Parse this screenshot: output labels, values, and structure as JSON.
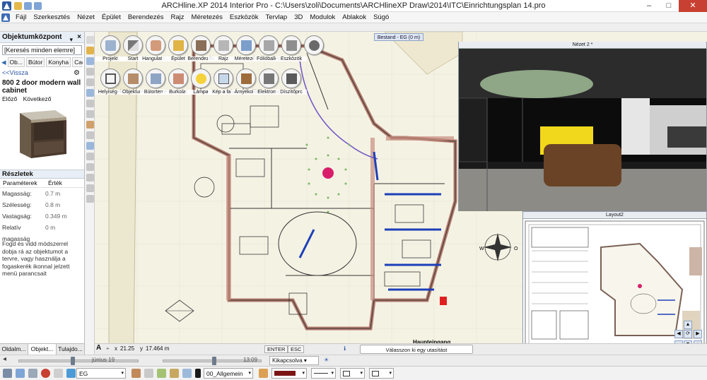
{
  "window": {
    "title": "ARCHline.XP 2014 Interior Pro - C:\\Users\\zoli\\Documents\\ARCHlineXP Draw\\2014\\ITC\\Einrichtungsplan 14.pro",
    "minimize": "–",
    "maximize": "□",
    "close": "✕"
  },
  "menu": [
    "Fájl",
    "Szerkesztés",
    "Nézet",
    "Épület",
    "Berendezés",
    "Rajz",
    "Méretezés",
    "Eszközök",
    "Tervlap",
    "3D",
    "Modulok",
    "Ablakok",
    "Súgó"
  ],
  "left_panel": {
    "title": "Objektumközpont",
    "pin": "▾ ×",
    "search_placeholder": "[Keresés minden elemre]",
    "breadcrumbs": [
      "Ob...",
      "Bútor",
      "Konyha",
      "Cad"
    ],
    "back": "<<Vissza",
    "object_name": "800 2 door modern wall cabinet",
    "prev": "Előző",
    "next": "Következő",
    "details_title": "Részletek",
    "col_param": "Paraméterek",
    "col_value": "Érték",
    "params": [
      {
        "name": "Magasság:",
        "value": "0.7 m"
      },
      {
        "name": "Szélesség:",
        "value": "0.8 m"
      },
      {
        "name": "Vastagság:",
        "value": "0.349 m"
      },
      {
        "name": "Relatív magasság",
        "value": "0 m"
      }
    ],
    "hint": "Fogd és vidd módszerrel dobja rá az objektumot a tervre, vagy használja a fogaskerék ikonnal jelzett menü parancsait",
    "tabs": [
      "Oldalm...",
      "Objekt...",
      "Tulajdo..."
    ]
  },
  "tools": [
    {
      "label": "Projekt",
      "icon": "project-icon"
    },
    {
      "label": "Start",
      "icon": "stairs-icon"
    },
    {
      "label": "Hangulat r...",
      "icon": "mood-icon"
    },
    {
      "label": "Épület",
      "icon": "building-icon"
    },
    {
      "label": "Berendezés",
      "icon": "furniture-icon"
    },
    {
      "label": "Rajz",
      "icon": "drawing-icon"
    },
    {
      "label": "Méretezés",
      "icon": "dimension-icon"
    },
    {
      "label": "Fólióballeo",
      "icon": "layers-icon"
    },
    {
      "label": "Eszközök",
      "icon": "tools-icon"
    },
    {
      "label": "Helyiségek",
      "icon": "rooms-icon"
    },
    {
      "label": "Objektum",
      "icon": "object-icon"
    },
    {
      "label": "Bútorterve",
      "icon": "furniture-plan-icon"
    },
    {
      "label": "Burkolat",
      "icon": "cladding-icon"
    },
    {
      "label": "Lámpa",
      "icon": "lamp-icon"
    },
    {
      "label": "Kép a falo",
      "icon": "wall-picture-icon"
    },
    {
      "label": "Árnyékolót",
      "icon": "shading-icon"
    },
    {
      "label": "Elektromo",
      "icon": "electric-icon"
    },
    {
      "label": "Díszítőprc",
      "icon": "decoration-icon"
    }
  ],
  "level_badge": "Bestand - EG (0 m)",
  "view3d_title": "Nézet 2 *",
  "layout_title": "Layout2",
  "plan_label": "Haupteingang",
  "compass_letters": [
    "W",
    "O"
  ],
  "status": {
    "x": "21.25",
    "y": "17.464 m",
    "enter": "ENTER",
    "esc": "ESC",
    "message": "Válasszon ki egy utasítást"
  },
  "timeline": {
    "date": "június 19",
    "time": "13:09",
    "sun": "Kikapcsolva"
  },
  "bottom": {
    "floor": "EG",
    "layer": "00_Allgemein"
  },
  "colors": {
    "accent": "#d81e6b",
    "wall": "#b37a6d",
    "plan_bg": "#f4f2e3",
    "blue_lines": "#1c3fb8"
  }
}
